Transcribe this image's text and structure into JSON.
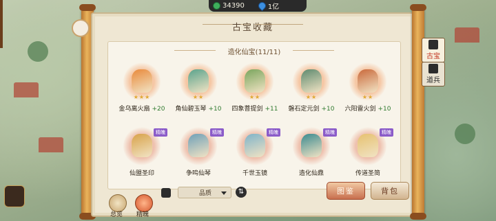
{
  "currency": {
    "jade": "34390",
    "diamond": "1亿"
  },
  "panel": {
    "title": "古宝收藏",
    "subtitle": "造化仙宝(11/11)"
  },
  "treasures_row1": [
    {
      "name": "金乌离火扇",
      "level": "+20",
      "stars": "★★★",
      "art": "gold",
      "hue": "#e98a3b"
    },
    {
      "name": "角仙碧玉琴",
      "level": "+10",
      "stars": "★★",
      "art": "gold",
      "hue": "#5aa38c"
    },
    {
      "name": "四象菩提剑",
      "level": "+11",
      "stars": "★★",
      "art": "gold",
      "hue": "#7aa55d"
    },
    {
      "name": "磐石定元剑",
      "level": "+10",
      "stars": "★★",
      "art": "gold",
      "hue": "#5e8a6f"
    },
    {
      "name": "六阳雷火剑",
      "level": "+10",
      "stars": "★★",
      "art": "gold",
      "hue": "#c9693b"
    }
  ],
  "treasures_row2": [
    {
      "name": "仙盟圣印",
      "badge": "精魄",
      "art": "purple",
      "hue": "#d8a24a"
    },
    {
      "name": "争鸣仙琴",
      "badge": "精魄",
      "art": "purple",
      "hue": "#6fa0b8"
    },
    {
      "name": "千世玉镜",
      "badge": "精魄",
      "art": "purple",
      "hue": "#7fb3c9"
    },
    {
      "name": "造化仙鼎",
      "badge": "精魄",
      "art": "purple",
      "hue": "#3a8a8f"
    },
    {
      "name": "传道圣简",
      "badge": "精魄",
      "art": "purple",
      "hue": "#e6c170"
    }
  ],
  "controls": {
    "overview": "总览",
    "cultivate": "精魄",
    "quality_select": "品质",
    "atlas_button": "图鉴",
    "bag_button": "背包"
  },
  "side_tabs": {
    "treasure": "古宝",
    "weapon": "道兵"
  }
}
